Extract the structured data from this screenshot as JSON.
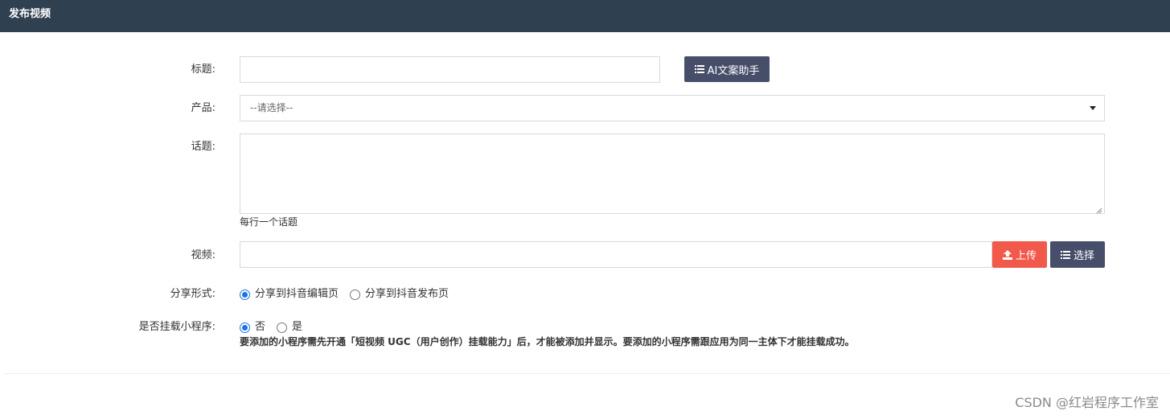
{
  "header": {
    "title": "发布视频"
  },
  "form": {
    "title_label": "标题:",
    "title_value": "",
    "ai_button_label": "AI文案助手",
    "product_label": "产品:",
    "product_selected": "--请选择--",
    "topic_label": "话题:",
    "topic_value": "",
    "topic_hint": "每行一个话题",
    "video_label": "视频:",
    "video_value": "",
    "upload_button_label": "上传",
    "choose_button_label": "选择",
    "share_label": "分享形式:",
    "share_options": [
      {
        "label": "分享到抖音编辑页",
        "checked": true
      },
      {
        "label": "分享到抖音发布页",
        "checked": false
      }
    ],
    "mount_label": "是否挂载小程序:",
    "mount_options": [
      {
        "label": "否",
        "checked": true
      },
      {
        "label": "是",
        "checked": false
      }
    ],
    "mount_note": "要添加的小程序需先开通「短视频 UGC（用户创作）挂载能力」后，才能被添加并显示。要添加的小程序需跟应用为同一主体下才能挂载成功。"
  },
  "watermark": "CSDN @红岩程序工作室",
  "colors": {
    "header_bg": "#2f4050",
    "button_dark": "#474e6a",
    "button_red": "#f15a4a",
    "radio_accent": "#1a73e8"
  },
  "icons": {
    "ai_button": "list-icon",
    "upload_button": "upload-icon",
    "choose_button": "list-icon"
  }
}
